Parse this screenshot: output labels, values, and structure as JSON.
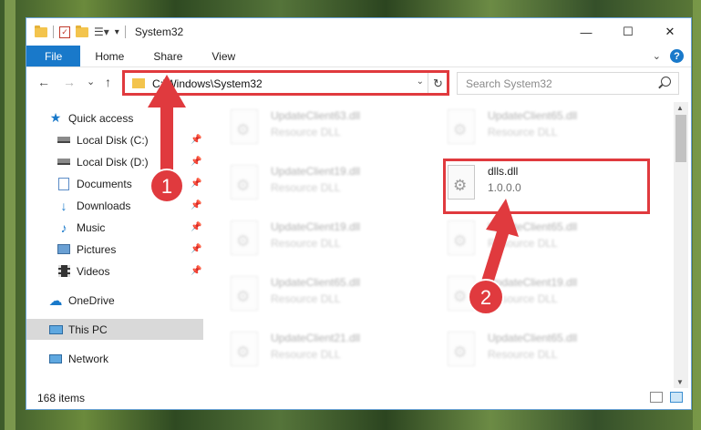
{
  "window": {
    "title": "System32",
    "controls": {
      "minimize": "—",
      "maximize": "☐",
      "close": "✕"
    }
  },
  "ribbon": {
    "tabs": [
      "File",
      "Home",
      "Share",
      "View"
    ],
    "expand_icon": "chevron-down-icon",
    "help": "?"
  },
  "navigation": {
    "back": "←",
    "forward": "→",
    "recent": "⌄",
    "up": "↑",
    "address": "C:\\Windows\\System32",
    "address_dropdown": "⌄",
    "refresh": "↻",
    "search_placeholder": "Search System32"
  },
  "sidebar": {
    "items": [
      {
        "label": "Quick access",
        "icon": "star-icon",
        "pinned": false
      },
      {
        "label": "Local Disk (C:)",
        "icon": "drive-icon",
        "pinned": true
      },
      {
        "label": "Local Disk (D:)",
        "icon": "drive-icon",
        "pinned": true
      },
      {
        "label": "Documents",
        "icon": "documents-icon",
        "pinned": true
      },
      {
        "label": "Downloads",
        "icon": "download-icon",
        "pinned": true
      },
      {
        "label": "Music",
        "icon": "music-icon",
        "pinned": true
      },
      {
        "label": "Pictures",
        "icon": "pictures-icon",
        "pinned": true
      },
      {
        "label": "Videos",
        "icon": "videos-icon",
        "pinned": true
      },
      {
        "label": "OneDrive",
        "icon": "cloud-icon",
        "pinned": false
      },
      {
        "label": "This PC",
        "icon": "computer-icon",
        "pinned": false,
        "selected": true
      },
      {
        "label": "Network",
        "icon": "network-icon",
        "pinned": false
      }
    ]
  },
  "files": [
    {
      "name": "UpdateClient63.dll",
      "type": "Resource DLL",
      "blurred": true
    },
    {
      "name": "UpdateClient65.dll",
      "type": "Resource DLL",
      "blurred": true
    },
    {
      "name": "UpdateClient19.dll",
      "type": "Resource DLL",
      "blurred": true
    },
    {
      "name": "dlls.dll",
      "type": "1.0.0.0",
      "blurred": false,
      "highlighted": true
    },
    {
      "name": "UpdateClient19.dll",
      "type": "Resource DLL",
      "blurred": true
    },
    {
      "name": "UpdateClient65.dll",
      "type": "Resource DLL",
      "blurred": true
    },
    {
      "name": "UpdateClient65.dll",
      "type": "Resource DLL",
      "blurred": true
    },
    {
      "name": "UpdateClient19.dll",
      "type": "Resource DLL",
      "blurred": true
    },
    {
      "name": "UpdateClient21.dll",
      "type": "Resource DLL",
      "blurred": true
    },
    {
      "name": "UpdateClient65.dll",
      "type": "Resource DLL",
      "blurred": true
    }
  ],
  "status": {
    "item_count": "168 items"
  },
  "annotations": {
    "step1": "1",
    "step2": "2",
    "color": "#e03a3e"
  }
}
